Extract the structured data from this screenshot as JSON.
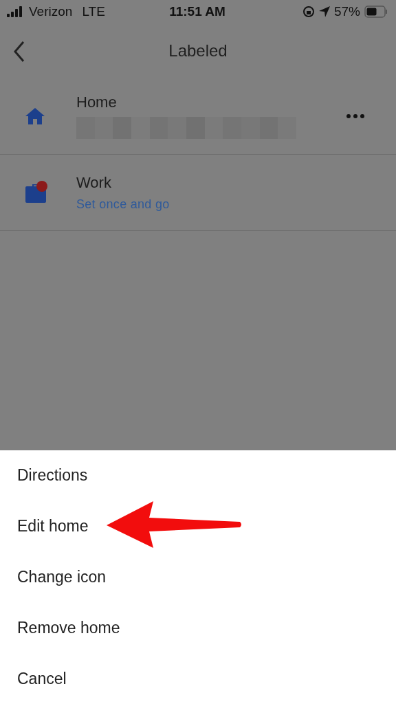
{
  "status_bar": {
    "carrier": "Verizon",
    "network": "LTE",
    "time": "11:51 AM",
    "battery": "57%"
  },
  "header": {
    "title": "Labeled"
  },
  "places": [
    {
      "kind": "home",
      "title": "Home",
      "address_hidden": true,
      "menu": true
    },
    {
      "kind": "work",
      "title": "Work",
      "subtitle": "Set once and go",
      "menu": false
    }
  ],
  "action_sheet": {
    "items": [
      {
        "label": "Directions",
        "pointed": false
      },
      {
        "label": "Edit home",
        "pointed": true
      },
      {
        "label": "Change icon",
        "pointed": false
      },
      {
        "label": "Remove home",
        "pointed": false
      },
      {
        "label": "Cancel",
        "pointed": false
      }
    ]
  }
}
